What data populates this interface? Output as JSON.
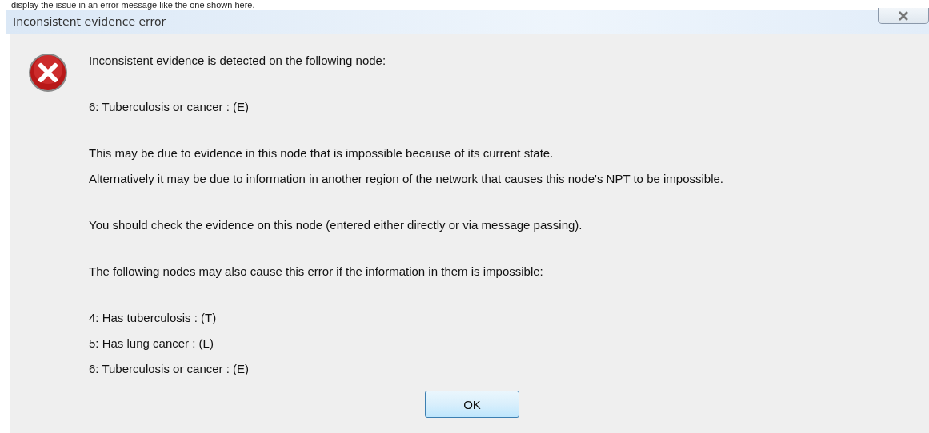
{
  "caption": "display the issue in an error message like the one shown here.",
  "window": {
    "title": "Inconsistent evidence error"
  },
  "message": {
    "paragraphs": [
      [
        "Inconsistent evidence is detected on the following node:"
      ],
      [
        "6: Tuberculosis or cancer : (E)"
      ],
      [
        "This may be due to evidence in this node that is impossible because of its current state.",
        "Alternatively it may be due to information in another region of the network that causes this node's NPT to be impossible."
      ],
      [
        "You should check the evidence on this node (entered either directly or via message passing)."
      ],
      [
        "The following nodes may also cause this error if the information in them is impossible:"
      ],
      [
        "4: Has tuberculosis :  (T)",
        "5: Has lung cancer :  (L)",
        "6: Tuberculosis or cancer :  (E)"
      ]
    ]
  },
  "buttons": [
    "OK"
  ]
}
